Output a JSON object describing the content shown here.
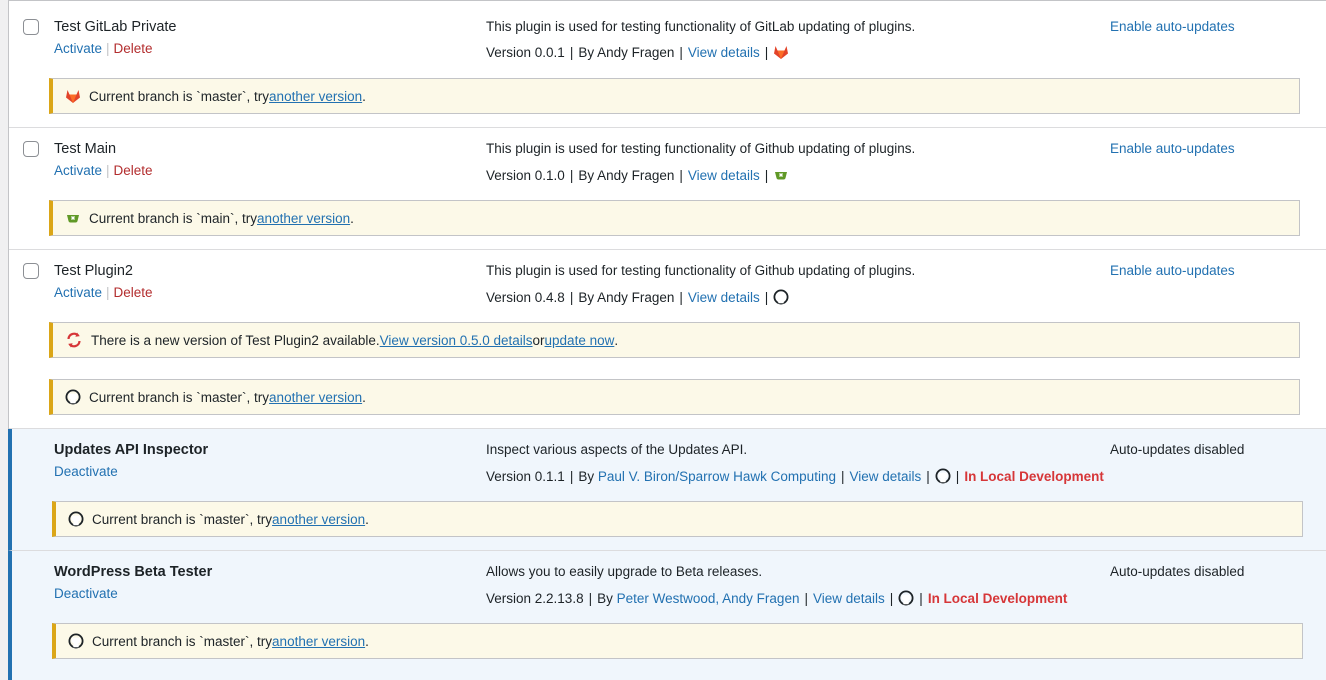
{
  "plugins": [
    {
      "name": "Test GitLab Private",
      "action1": "Activate",
      "action2": "Delete",
      "description": "This plugin is used for testing functionality of GitLab updating of plugins.",
      "version": "Version 0.0.1",
      "by": "By Andy Fragen",
      "view_details": "View details",
      "repo_icon": "gitlab-icon",
      "auto": "Enable auto-updates",
      "notice": {
        "pre": "Current branch is `master`, try ",
        "link": "another version",
        "post": "."
      }
    },
    {
      "name": "Test Main",
      "action1": "Activate",
      "action2": "Delete",
      "description": "This plugin is used for testing functionality of Github updating of plugins.",
      "version": "Version 0.1.0",
      "by": "By Andy Fragen",
      "view_details": "View details",
      "repo_icon": "gitea-icon",
      "auto": "Enable auto-updates",
      "notice": {
        "pre": "Current branch is `main`, try ",
        "link": "another version",
        "post": "."
      }
    },
    {
      "name": "Test Plugin2",
      "action1": "Activate",
      "action2": "Delete",
      "description": "This plugin is used for testing functionality of Github updating of plugins.",
      "version": "Version 0.4.8",
      "by": "By Andy Fragen",
      "view_details": "View details",
      "repo_icon": "github-icon",
      "auto": "Enable auto-updates",
      "update_notice": {
        "pre": "There is a new version of Test Plugin2 available. ",
        "link1": "View version 0.5.0 details",
        "mid": " or ",
        "link2": "update now",
        "post": "."
      },
      "notice": {
        "pre": "Current branch is `master`, try ",
        "link": "another version",
        "post": "."
      }
    },
    {
      "name": "Updates API Inspector",
      "action1": "Deactivate",
      "description": "Inspect various aspects of the Updates API.",
      "version": "Version 0.1.1",
      "by_pre": "By ",
      "author": "Paul V. Biron/Sparrow Hawk Computing",
      "view_details": "View details",
      "repo_icon": "github-icon",
      "dev": "In Local Development",
      "auto": "Auto-updates disabled",
      "notice": {
        "pre": "Current branch is `master`, try ",
        "link": "another version",
        "post": "."
      }
    },
    {
      "name": "WordPress Beta Tester",
      "action1": "Deactivate",
      "description": "Allows you to easily upgrade to Beta releases.",
      "version": "Version 2.2.13.8",
      "by_pre": "By ",
      "author": "Peter Westwood, Andy Fragen",
      "view_details": "View details",
      "repo_icon": "github-icon",
      "dev": "In Local Development",
      "auto": "Auto-updates disabled",
      "notice": {
        "pre": "Current branch is `master`, try ",
        "link": "another version",
        "post": "."
      }
    }
  ],
  "pipe": "|",
  "colors": {
    "link": "#2271b1",
    "delete": "#b32d2e",
    "dev": "#d63638",
    "notice_border": "#dba617",
    "active_border": "#2271b1"
  }
}
